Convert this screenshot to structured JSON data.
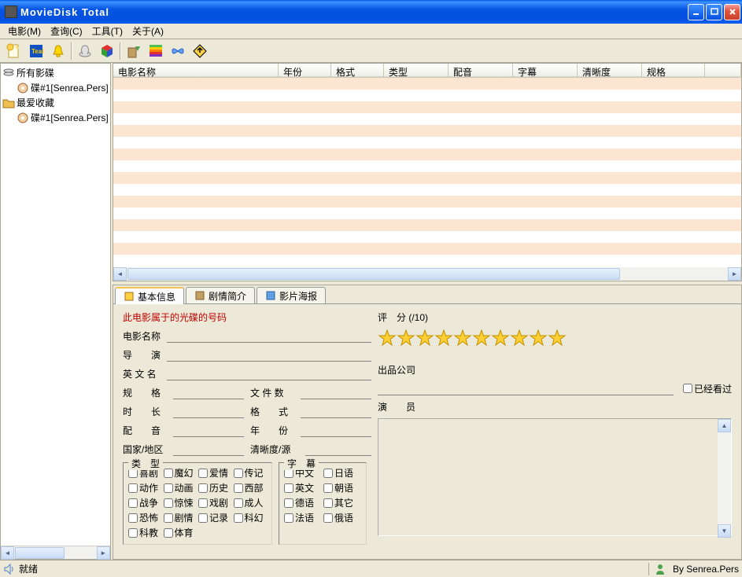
{
  "window": {
    "title": "MovieDisk Total"
  },
  "menu": {
    "movie": "电影(M)",
    "query": "查询(C)",
    "tools": "工具(T)",
    "about": "关于(A)"
  },
  "tree": {
    "all_disks": "所有影碟",
    "disk1_a": "碟#1[Senrea.Pers]",
    "favorites": "最爱收藏",
    "disk1_b": "碟#1[Senrea.Pers]"
  },
  "columns": {
    "name": "电影名称",
    "year": "年份",
    "format": "格式",
    "type": "类型",
    "dub": "配音",
    "subtitle": "字幕",
    "clarity": "清晰度",
    "spec": "规格"
  },
  "tabs": {
    "basic": "基本信息",
    "plot": "剧情简介",
    "poster": "影片海报"
  },
  "detail": {
    "disc_number_label": "此电影属于的光碟的号码",
    "movie_name": "电影名称",
    "director": "导　　演",
    "english_name": "英 文 名",
    "spec": "规　　格",
    "file_count": "文 件 数",
    "duration": "时　　长",
    "format": "格　　式",
    "dub": "配　　音",
    "year": "年　　份",
    "country": "国家/地区",
    "clarity_source": "清晰度/源",
    "rating_label": "评　分 (/10)",
    "company": "出品公司",
    "watched": "已经看过",
    "actors": "演　　员",
    "genre_legend": "类　型",
    "subtitle_legend": "字　幕"
  },
  "genres": [
    "喜剧",
    "魔幻",
    "爱情",
    "传记",
    "动作",
    "动画",
    "历史",
    "西部",
    "战争",
    "惊悚",
    "戏剧",
    "成人",
    "恐怖",
    "剧情",
    "记录",
    "科幻",
    "科教",
    "体育"
  ],
  "subtitles": [
    "中文",
    "日语",
    "英文",
    "朝语",
    "德语",
    "其它",
    "法语",
    "俄语"
  ],
  "status": {
    "ready": "就绪",
    "author": "By Senrea.Pers"
  }
}
